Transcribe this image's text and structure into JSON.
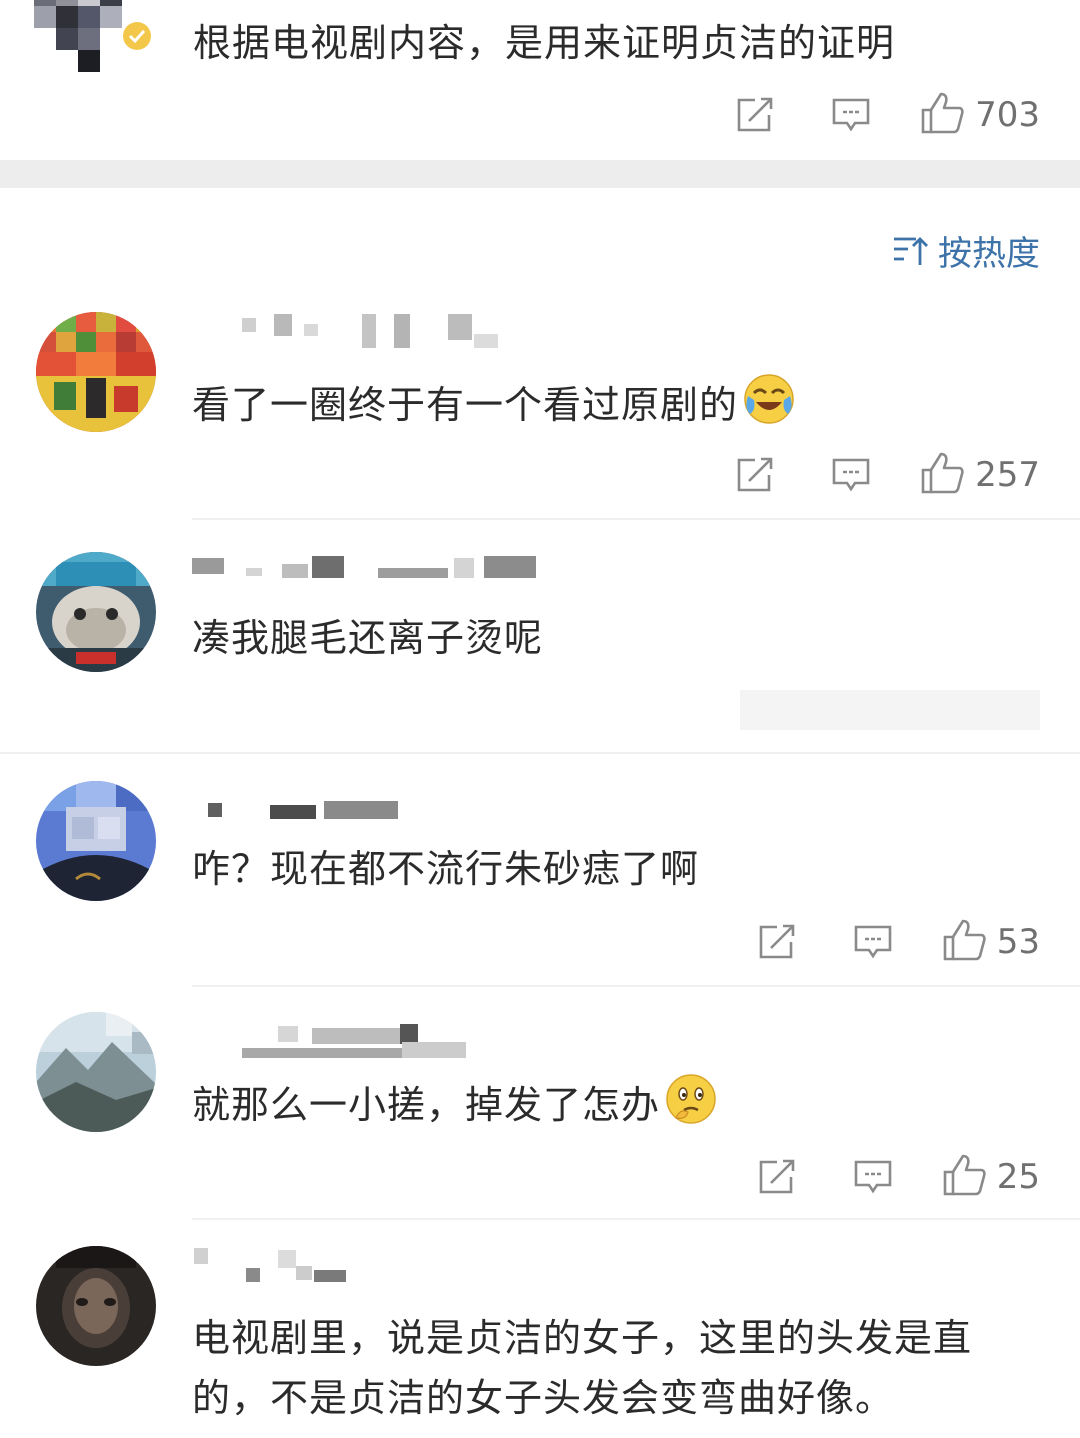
{
  "top_comment": {
    "text": "根据电视剧内容，是用来证明贞洁的证明",
    "like_count": "703",
    "share_icon": "share-icon",
    "reply_icon": "comment-icon",
    "like_icon": "thumbs-up-icon"
  },
  "sort": {
    "label": "按热度",
    "icon": "sort-icon"
  },
  "comments": [
    {
      "text": "看了一圈终于有一个看过原剧的",
      "emoji": "laughing-crying-emoji",
      "like_count": "257"
    },
    {
      "text": "凑我腿毛还离子烫呢",
      "like_count": ""
    },
    {
      "text": "咋？现在都不流行朱砂痣了啊",
      "like_count": "53"
    },
    {
      "text": "就那么一小搓，掉发了怎办",
      "emoji": "thinking-emoji",
      "like_count": "25"
    },
    {
      "text_line1": "电视剧里，说是贞洁的女子，这里的头发是直",
      "text_line2": "的，不是贞洁的女子头发会变弯曲好像。"
    }
  ],
  "colors": {
    "link_blue": "#3d73a8",
    "icon_gray": "#8a8a8a",
    "band_gray": "#ededed"
  }
}
